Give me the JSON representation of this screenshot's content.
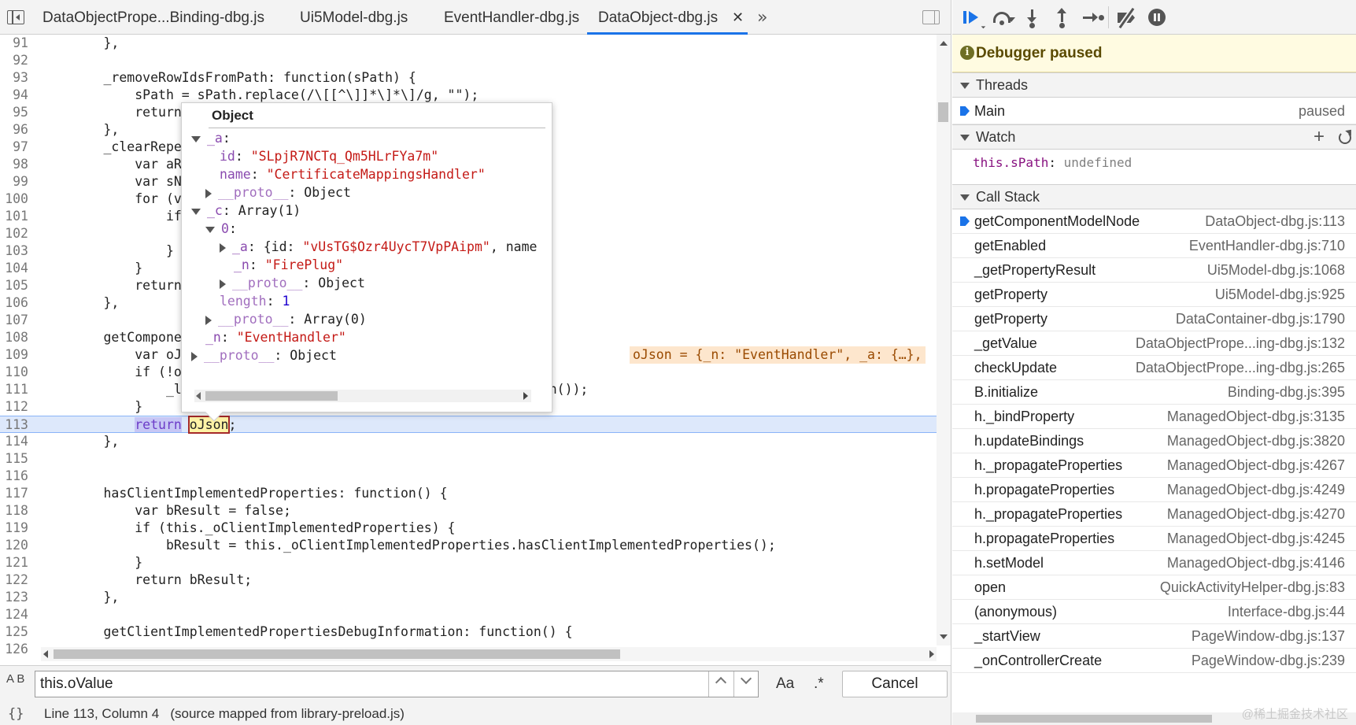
{
  "tabs": [
    {
      "label": "DataObjectPrope...Binding-dbg.js",
      "active": false
    },
    {
      "label": "Ui5Model-dbg.js",
      "active": false
    },
    {
      "label": "EventHandler-dbg.js",
      "active": false
    },
    {
      "label": "DataObject-dbg.js",
      "active": true
    }
  ],
  "tab_close_glyph": "✕",
  "tab_more_glyph": "»",
  "code_lines": [
    {
      "n": "91",
      "t": "        },"
    },
    {
      "n": "92",
      "t": ""
    },
    {
      "n": "93",
      "t": "        _removeRowIdsFromPath: function(sPath) {"
    },
    {
      "n": "94",
      "t": "            sPath = sPath.replace(/\\[[^\\]]*\\]*\\]/g, \"\");"
    },
    {
      "n": "95",
      "t": "            return"
    },
    {
      "n": "96",
      "t": "        },"
    },
    {
      "n": "97",
      "t": "        _clearRepe"
    },
    {
      "n": "98",
      "t": "            var aR"
    },
    {
      "n": "99",
      "t": "            var sN"
    },
    {
      "n": "100",
      "t": "            for (v"
    },
    {
      "n": "101",
      "t": "                if"
    },
    {
      "n": "102",
      "t": ""
    },
    {
      "n": "103",
      "t": "                }"
    },
    {
      "n": "104",
      "t": "            }"
    },
    {
      "n": "105",
      "t": "            return"
    },
    {
      "n": "106",
      "t": "        },"
    },
    {
      "n": "107",
      "t": ""
    },
    {
      "n": "108",
      "t": "        getCompone"
    },
    {
      "n": "109",
      "t": "            var oJ                              s._sId);"
    },
    {
      "n": "110",
      "t": "            if (!o"
    },
    {
      "n": "111",
      "t": "                _l                                \" + this.getPath());"
    },
    {
      "n": "112",
      "t": "            }"
    },
    {
      "n": "113",
      "t": "            return oJson;"
    },
    {
      "n": "114",
      "t": "        },"
    },
    {
      "n": "115",
      "t": ""
    },
    {
      "n": "116",
      "t": ""
    },
    {
      "n": "117",
      "t": "        hasClientImplementedProperties: function() {"
    },
    {
      "n": "118",
      "t": "            var bResult = false;"
    },
    {
      "n": "119",
      "t": "            if (this._oClientImplementedProperties) {"
    },
    {
      "n": "120",
      "t": "                bResult = this._oClientImplementedProperties.hasClientImplementedProperties();"
    },
    {
      "n": "121",
      "t": "            }"
    },
    {
      "n": "122",
      "t": "            return bResult;"
    },
    {
      "n": "123",
      "t": "        },"
    },
    {
      "n": "124",
      "t": ""
    },
    {
      "n": "125",
      "t": "        getClientImplementedPropertiesDebugInformation: function() {"
    },
    {
      "n": "126",
      "t": ""
    }
  ],
  "inline_value": "oJson = {_n: \"EventHandler\", _a: {…},",
  "popover": {
    "title": "Object",
    "a_key": "_a",
    "id_key": "id",
    "id_val": "\"SLpjR7NCTq_Qm5HLrFYa7m\"",
    "name_key": "name",
    "name_val": "\"CertificateMappingsHandler\"",
    "proto_key": "__proto__",
    "object_label": "Object",
    "c_key": "_c",
    "c_val": "Array(1)",
    "idx0": "0",
    "a2_prefix": "{id: ",
    "a2_id": "\"vUsTG$Ozr4UycT7VpPAipm\"",
    "a2_suffix": ", name",
    "n_key": "_n",
    "n2_val": "\"FirePlug\"",
    "length_key": "length",
    "length_val": "1",
    "array0": "Array(0)",
    "n_val": "\"EventHandler\""
  },
  "search": {
    "label_icon": "A B",
    "value": "this.oValue",
    "case_label": "Aa",
    "regex_label": ".*",
    "cancel": "Cancel"
  },
  "status": {
    "braces": "{}",
    "text": "Line 113, Column 4   (source mapped from library-preload.js)"
  },
  "debugger": {
    "paused_text": "Debugger paused",
    "threads_label": "Threads",
    "thread_main": "Main",
    "thread_state": "paused",
    "watch_label": "Watch",
    "watch_expr": "this.sPath",
    "watch_value": "undefined",
    "callstack_label": "Call Stack"
  },
  "call_stack": [
    {
      "name": "getComponentModelNode",
      "loc": "DataObject-dbg.js:113",
      "current": true
    },
    {
      "name": "getEnabled",
      "loc": "EventHandler-dbg.js:710"
    },
    {
      "name": "_getPropertyResult",
      "loc": "Ui5Model-dbg.js:1068"
    },
    {
      "name": "getProperty",
      "loc": "Ui5Model-dbg.js:925"
    },
    {
      "name": "getProperty",
      "loc": "DataContainer-dbg.js:1790"
    },
    {
      "name": "_getValue",
      "loc": "DataObjectPrope...ing-dbg.js:132"
    },
    {
      "name": "checkUpdate",
      "loc": "DataObjectPrope...ing-dbg.js:265"
    },
    {
      "name": "B.initialize",
      "loc": "Binding-dbg.js:395"
    },
    {
      "name": "h._bindProperty",
      "loc": "ManagedObject-dbg.js:3135"
    },
    {
      "name": "h.updateBindings",
      "loc": "ManagedObject-dbg.js:3820"
    },
    {
      "name": "h._propagateProperties",
      "loc": "ManagedObject-dbg.js:4267"
    },
    {
      "name": "h.propagateProperties",
      "loc": "ManagedObject-dbg.js:4249"
    },
    {
      "name": "h._propagateProperties",
      "loc": "ManagedObject-dbg.js:4270"
    },
    {
      "name": "h.propagateProperties",
      "loc": "ManagedObject-dbg.js:4245"
    },
    {
      "name": "h.setModel",
      "loc": "ManagedObject-dbg.js:4146"
    },
    {
      "name": "open",
      "loc": "QuickActivityHelper-dbg.js:83"
    },
    {
      "name": "(anonymous)",
      "loc": "Interface-dbg.js:44"
    },
    {
      "name": "_startView",
      "loc": "PageWindow-dbg.js:137"
    },
    {
      "name": "_onControllerCreate",
      "loc": "PageWindow-dbg.js:239"
    }
  ],
  "watermark": "@稀土掘金技术社区",
  "colors": {
    "accent": "#1a73e8",
    "paused_bg": "#fffbe1",
    "highlight_line": "#dde8fb"
  }
}
